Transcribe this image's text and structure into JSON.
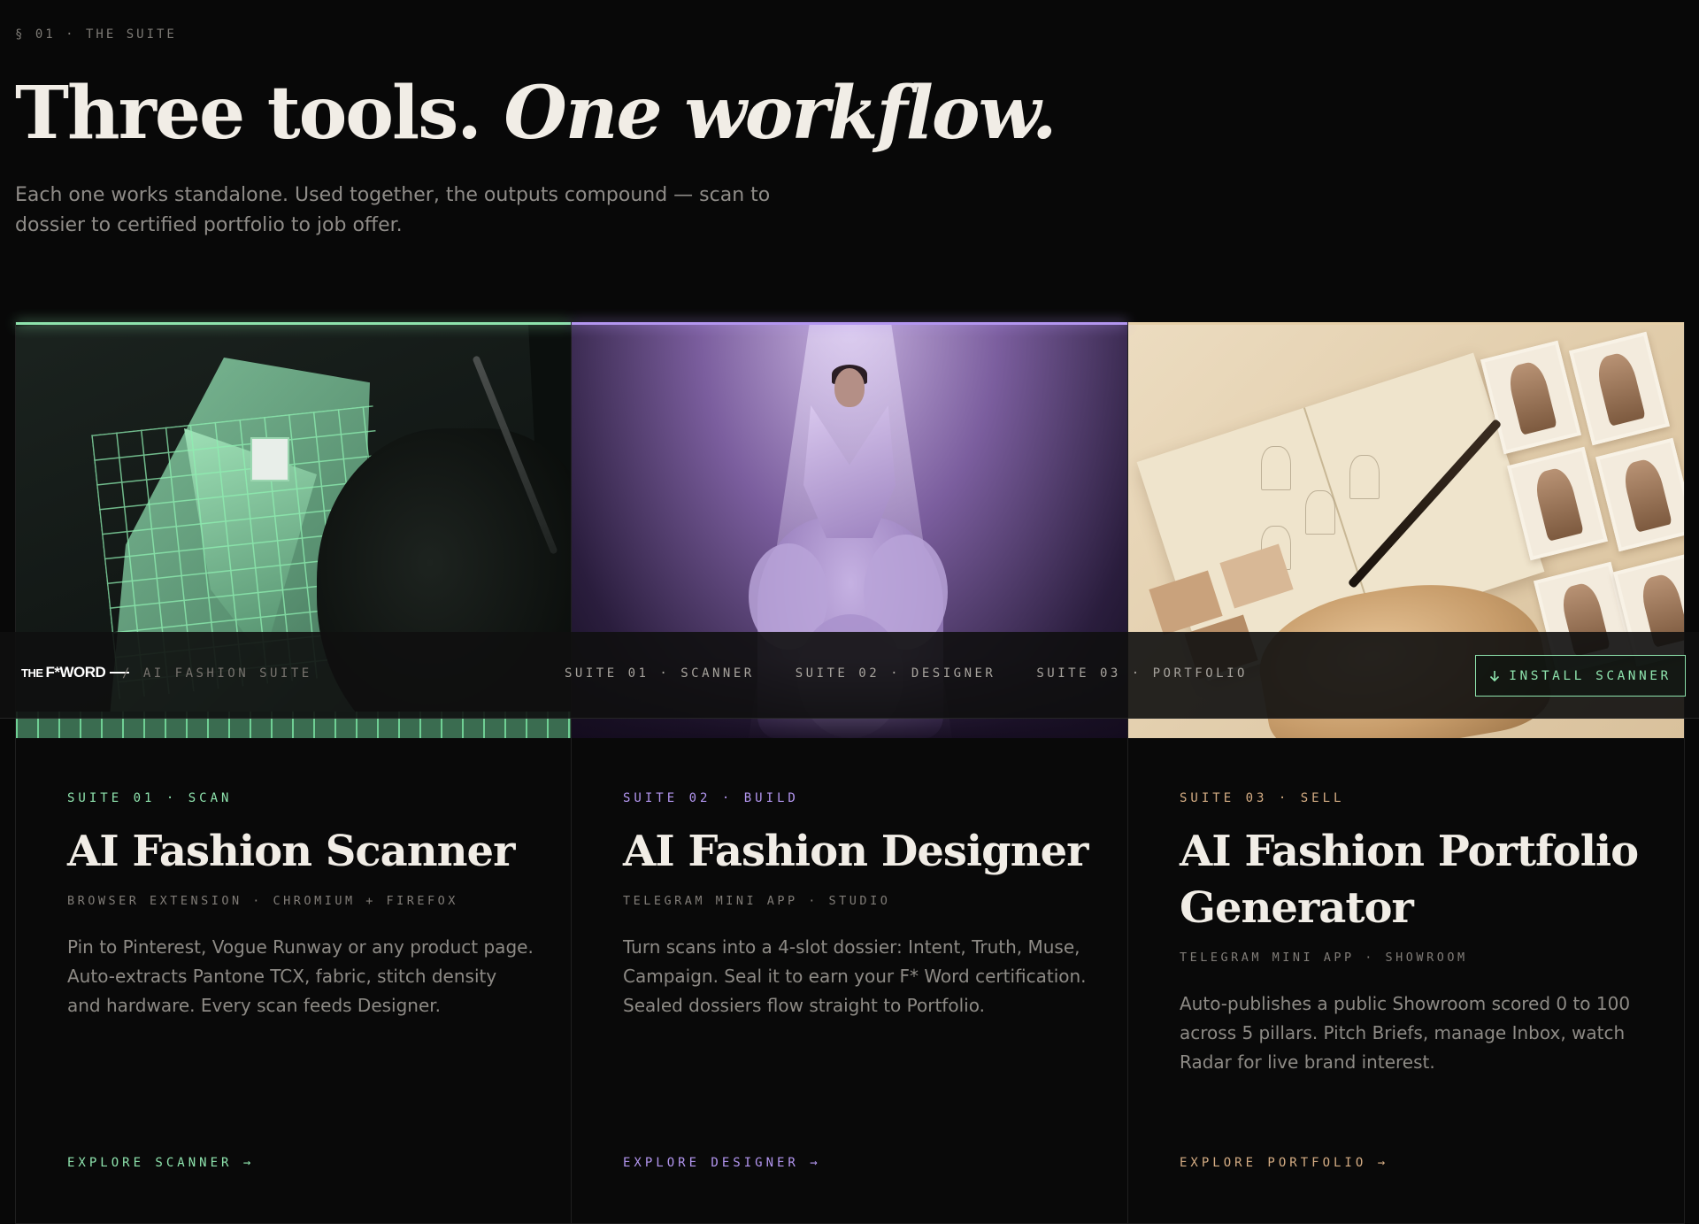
{
  "section": {
    "eyebrow": "§ 01 · THE SUITE",
    "headline_plain": "Three tools.",
    "headline_italic": "One workflow.",
    "subline": "Each one works standalone. Used together, the outputs compound — scan to dossier to certified portfolio to job offer."
  },
  "navbar": {
    "logo_the": "THE",
    "logo_fword": "F*WORD",
    "crumb": "/ AI FASHION SUITE",
    "links": [
      "SUITE 01 · SCANNER",
      "SUITE 02 · DESIGNER",
      "SUITE 03 · PORTFOLIO"
    ],
    "install_icon": "arrow-down-icon",
    "install_label": "INSTALL SCANNER"
  },
  "cards": [
    {
      "accent": "#8ee3ad",
      "label": "SUITE 01 · SCAN",
      "title": "AI Fashion Scanner",
      "meta": "BROWSER EXTENSION · CHROMIUM + FIREFOX",
      "description": "Pin to Pinterest, Vogue Runway or any product page. Auto-extracts Pantone TCX, fabric, stitch density and hardware. Every scan feeds Designer.",
      "cta": "EXPLORE SCANNER →"
    },
    {
      "accent": "#b396f0",
      "label": "SUITE 02 · BUILD",
      "title": "AI Fashion Designer",
      "meta": "TELEGRAM MINI APP · STUDIO",
      "description": "Turn scans into a 4-slot dossier: Intent, Truth, Muse, Campaign. Seal it to earn your F* Word certification. Sealed dossiers flow straight to Portfolio.",
      "cta": "EXPLORE DESIGNER →"
    },
    {
      "accent": "#d5ad84",
      "label": "SUITE 03 · SELL",
      "title": "AI Fashion Portfolio Generator",
      "meta": "TELEGRAM MINI APP · SHOWROOM",
      "description": "Auto-publishes a public Showroom scored 0 to 100 across 5 pillars. Pitch Briefs, manage Inbox, watch Radar for live brand interest.",
      "cta": "EXPLORE PORTFOLIO →"
    }
  ]
}
